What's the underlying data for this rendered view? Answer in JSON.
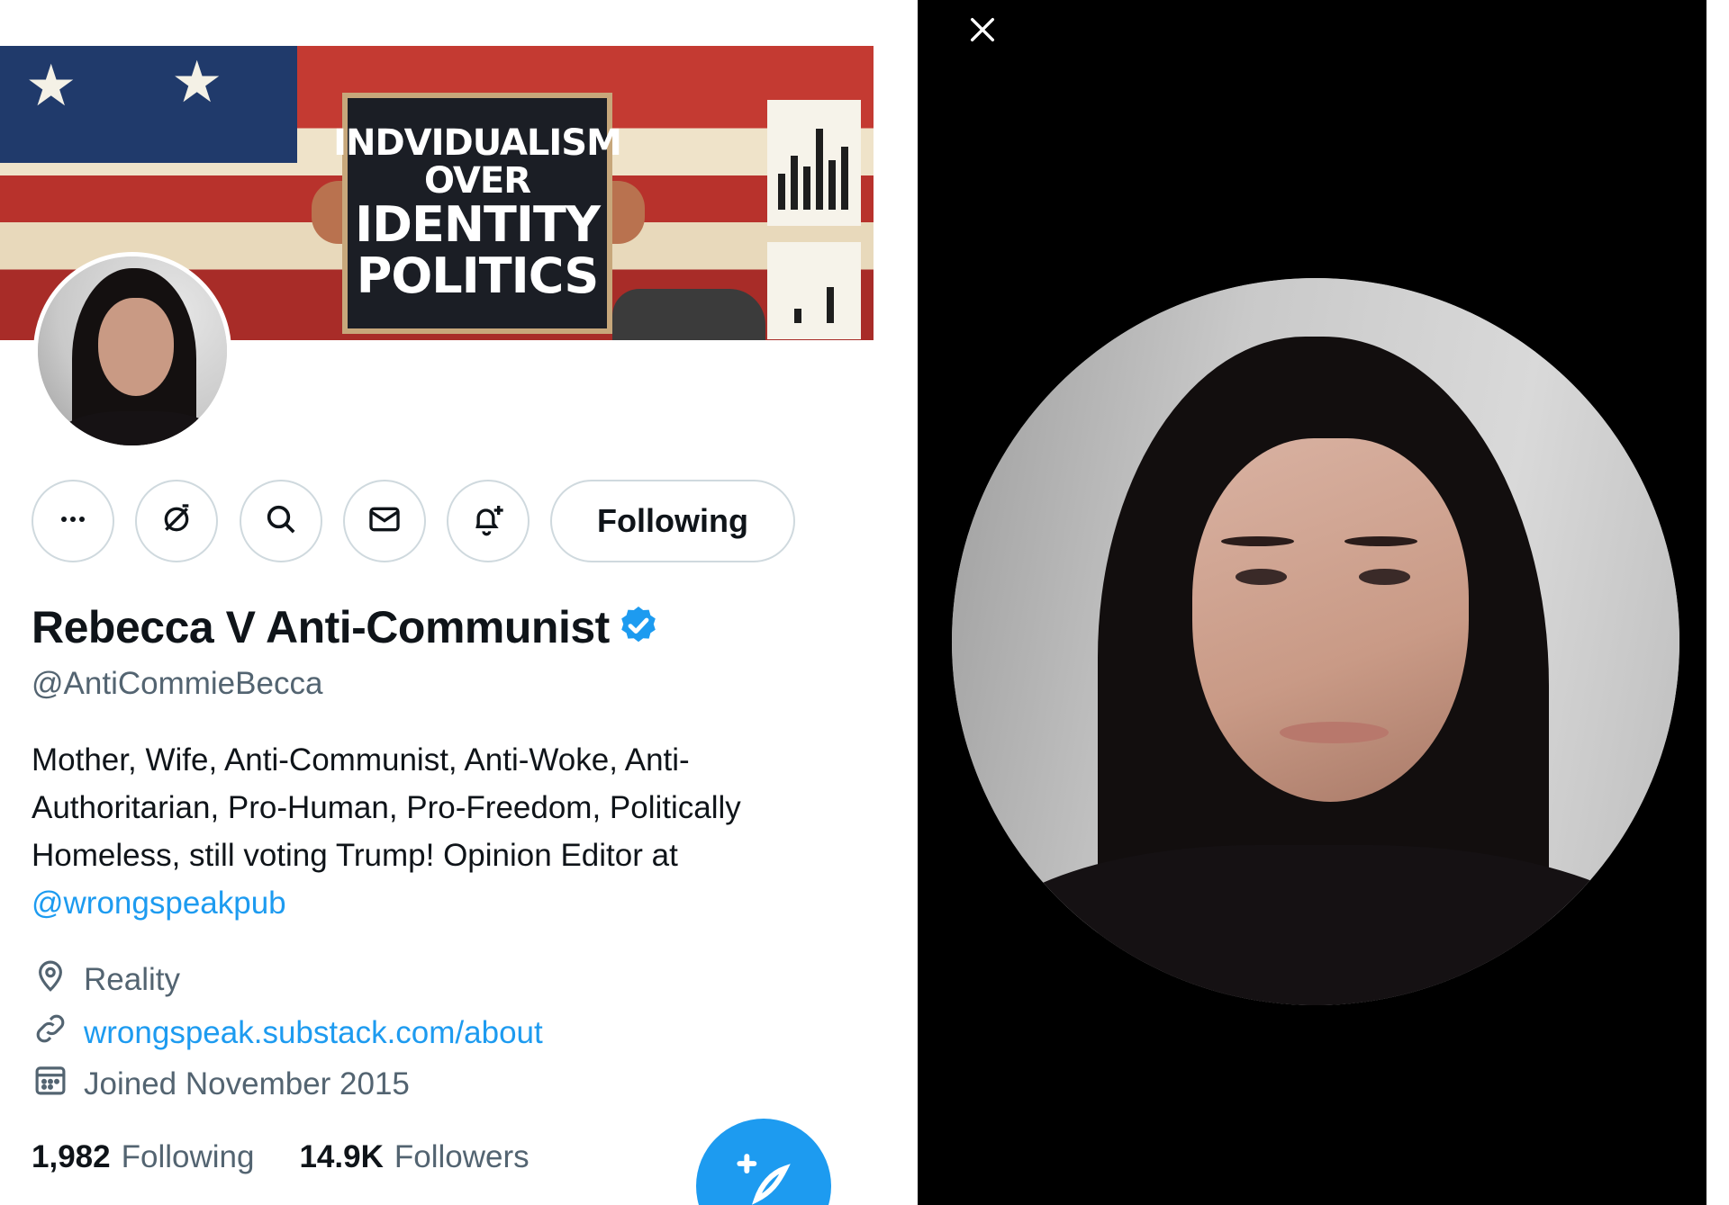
{
  "banner": {
    "sign_lines": [
      "INDVIDUALISM",
      "OVER",
      "IDENTITY",
      "POLITICS"
    ]
  },
  "actions": {
    "more_icon": "more-dots-icon",
    "muted_icon": "no-subscribe-icon",
    "search_icon": "search-icon",
    "message_icon": "mail-icon",
    "notify_icon": "bell-plus-icon",
    "following_label": "Following"
  },
  "profile": {
    "display_name": "Rebecca V Anti-Communist",
    "handle": "@AntiCommieBecca",
    "bio_text": "Mother, Wife, Anti-Communist, Anti-Woke, Anti-Authoritarian, Pro-Human, Pro-Freedom, Politically Homeless, still voting Trump! Opinion Editor at ",
    "bio_mention": "@wrongspeakpub",
    "location": "Reality",
    "website": "wrongspeak.substack.com/about",
    "joined": "Joined November 2015"
  },
  "stats": {
    "following_count": "1,982",
    "following_label": "Following",
    "followers_count": "14.9K",
    "followers_label": "Followers"
  },
  "colors": {
    "accent": "#1d9bf0",
    "secondary_text": "#536471",
    "viewer_bg": "#000000"
  }
}
